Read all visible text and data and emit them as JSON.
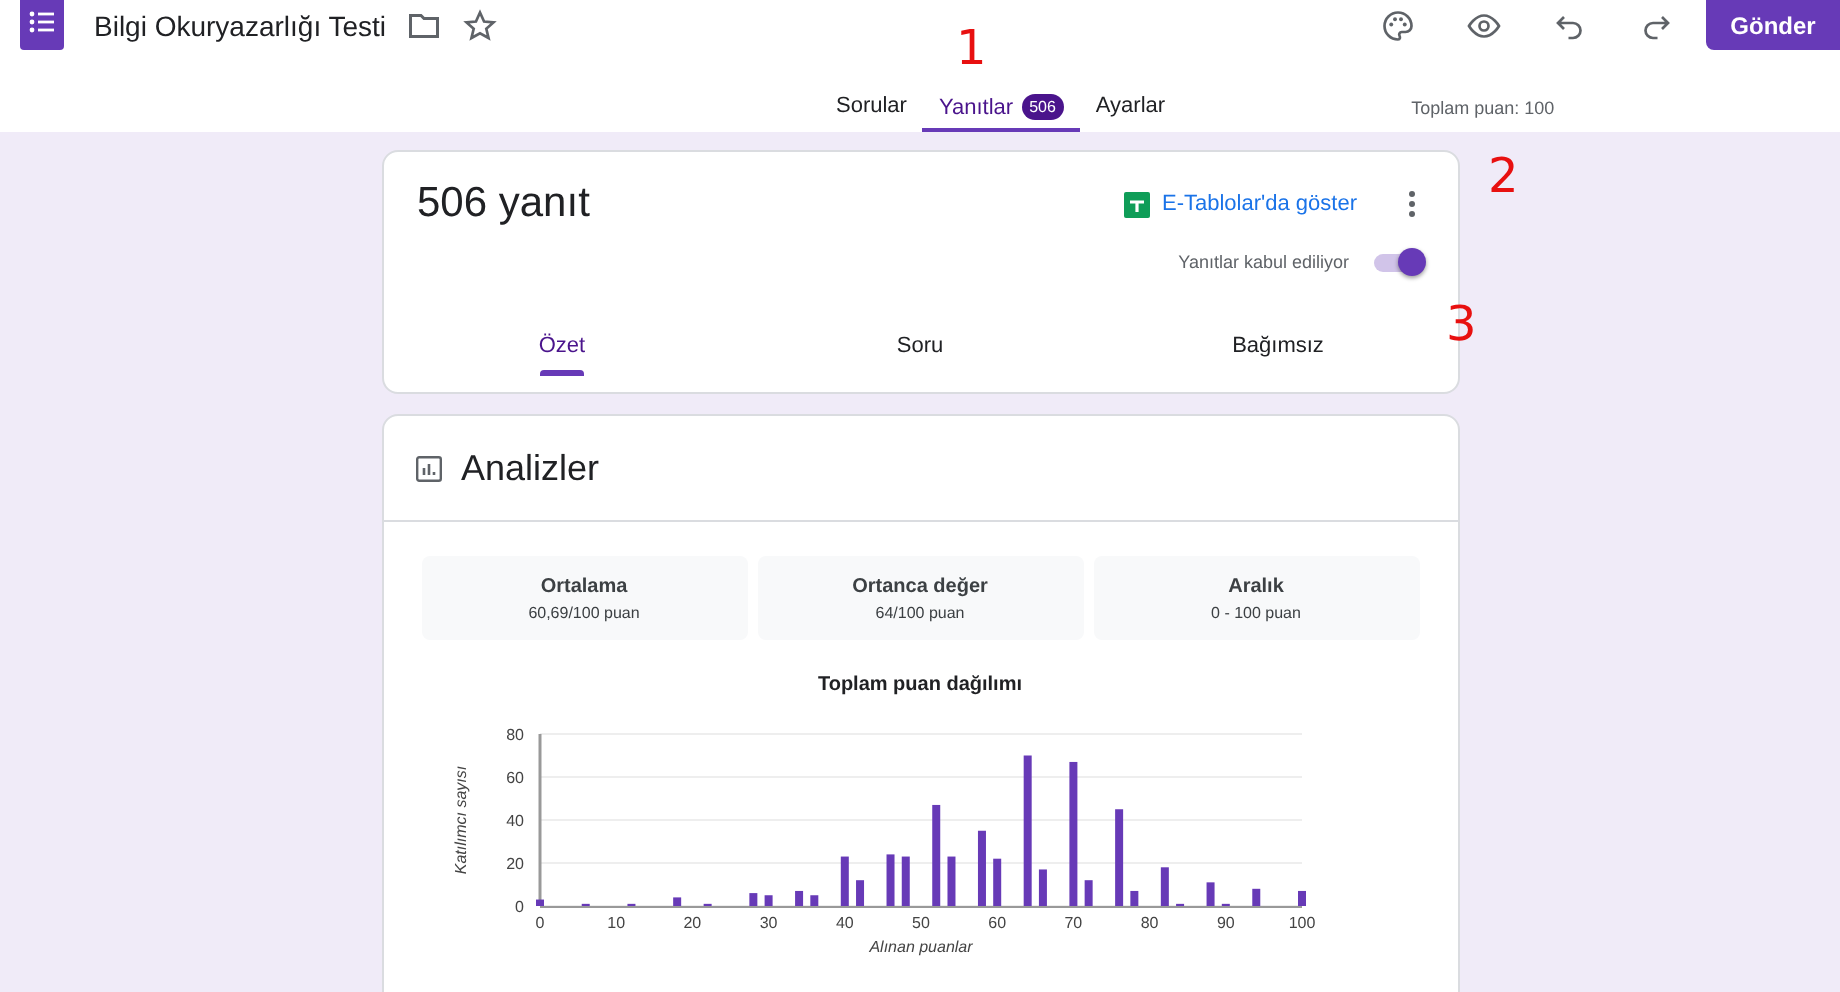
{
  "header": {
    "title": "Bilgi Okuryazarlığı Testi",
    "send_button": "Gönder"
  },
  "tabs": [
    {
      "label": "Sorular",
      "selected": false
    },
    {
      "label": "Yanıtlar",
      "selected": true,
      "badge": "506"
    },
    {
      "label": "Ayarlar",
      "selected": false
    }
  ],
  "total_points": "Toplam puan: 100",
  "responses_card": {
    "title": "506 yanıt",
    "sheets_link": "E-Tablolar'da göster",
    "accepting_label": "Yanıtlar kabul ediliyor",
    "accepting_on": true,
    "tabs": [
      {
        "label": "Özet",
        "selected": true
      },
      {
        "label": "Soru",
        "selected": false
      },
      {
        "label": "Bağımsız",
        "selected": false
      }
    ]
  },
  "insights_card": {
    "title": "Analizler",
    "stats": [
      {
        "label": "Ortalama",
        "value": "60,69/100 puan"
      },
      {
        "label": "Ortanca değer",
        "value": "64/100 puan"
      },
      {
        "label": "Aralık",
        "value": "0 - 100 puan"
      }
    ],
    "chart_data": {
      "type": "bar",
      "title": "Toplam puan dağılımı",
      "xlabel": "Alınan puanlar",
      "ylabel": "Katılımcı sayısı",
      "x": [
        0,
        6,
        12,
        18,
        22,
        28,
        30,
        34,
        36,
        40,
        42,
        46,
        48,
        52,
        54,
        58,
        60,
        64,
        66,
        70,
        72,
        76,
        78,
        82,
        84,
        88,
        90,
        94,
        100
      ],
      "grid": true,
      "series": [
        {
          "color": "#673ab7",
          "values": [
            3,
            1,
            1,
            4,
            1,
            6,
            5,
            7,
            5,
            23,
            12,
            24,
            23,
            47,
            23,
            35,
            22,
            70,
            17,
            67,
            12,
            45,
            7,
            18,
            1,
            11,
            1,
            8,
            7
          ]
        }
      ],
      "xlim": [
        0,
        100
      ],
      "ylim": [
        0,
        80
      ],
      "xticks": [
        0,
        10,
        20,
        30,
        40,
        50,
        60,
        70,
        80,
        90,
        100
      ],
      "yticks": [
        0,
        20,
        40,
        60,
        80
      ]
    }
  },
  "annotations": [
    {
      "label": "1",
      "kind": "tabs"
    },
    {
      "label": "2",
      "kind": "menu"
    },
    {
      "label": "3",
      "kind": "toggle"
    }
  ]
}
